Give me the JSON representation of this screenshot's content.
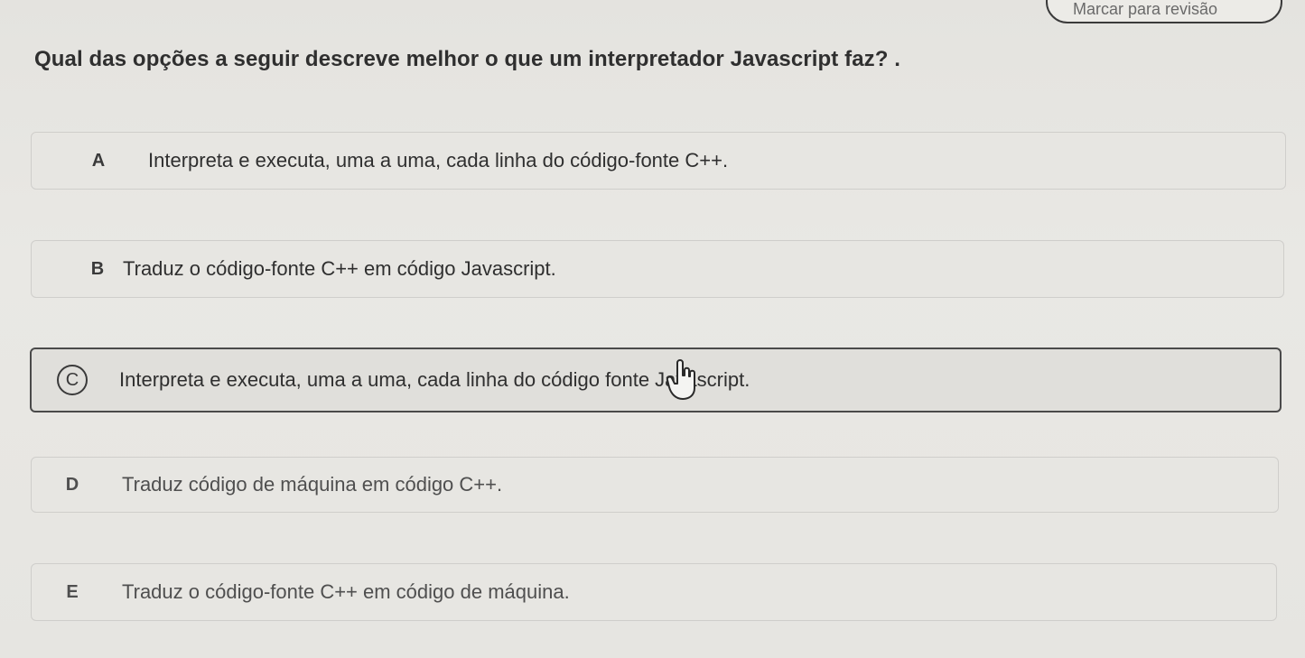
{
  "header": {
    "review_label": "Marcar para revisão"
  },
  "question": {
    "text": "Qual das opções a seguir descreve melhor o que um interpretador Javascript faz? ."
  },
  "options": [
    {
      "letter": "A",
      "text": "Interpreta e executa, uma a uma, cada linha do código-fonte C++.",
      "selected": false
    },
    {
      "letter": "B",
      "text": "Traduz o código-fonte C++ em código Javascript.",
      "selected": false
    },
    {
      "letter": "C",
      "text": "Interpreta e executa, uma a uma, cada linha do código fonte Javascript.",
      "selected": true
    },
    {
      "letter": "D",
      "text": "Traduz código de máquina em código C++.",
      "selected": false
    },
    {
      "letter": "E",
      "text": "Traduz o código-fonte C++ em código de máquina.",
      "selected": false
    }
  ],
  "cursor": {
    "icon": "hand-cursor-icon"
  },
  "colors": {
    "border_selected": "#4a4a4a",
    "border_default": "#cfcecb",
    "background": "#e6e5e1"
  }
}
